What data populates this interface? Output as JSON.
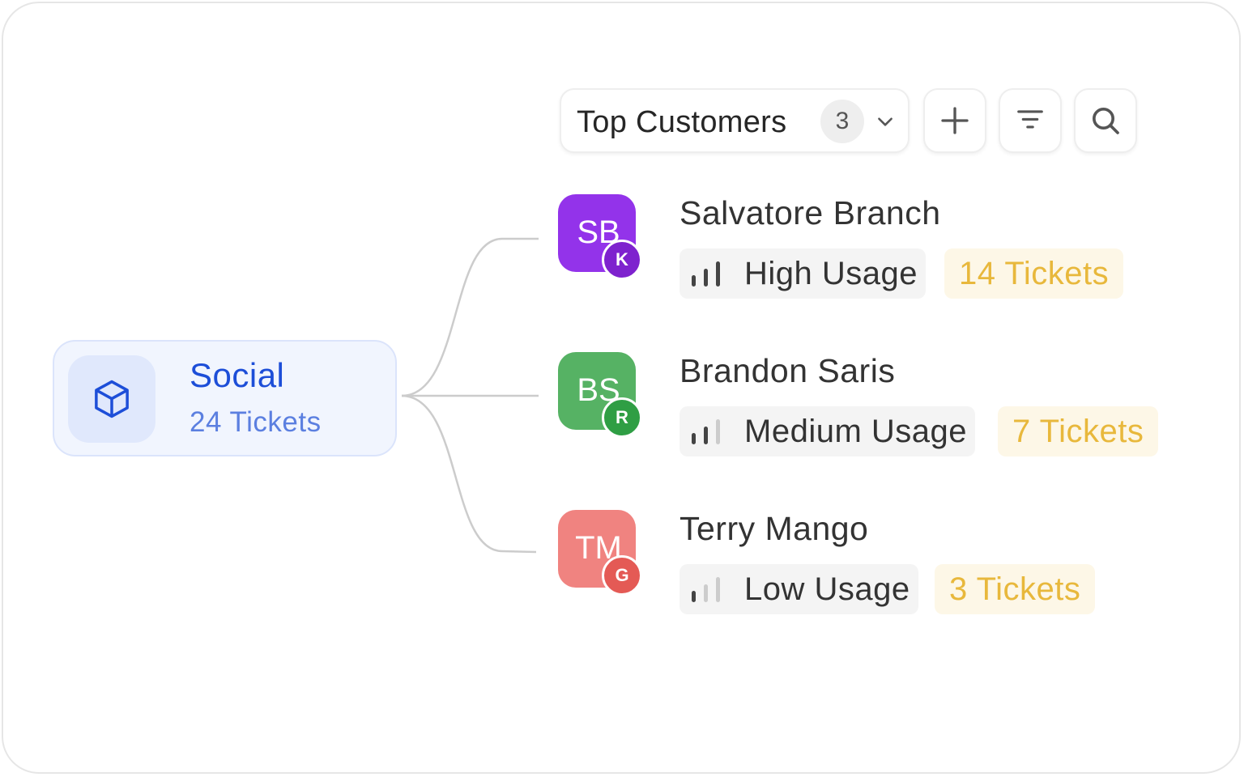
{
  "colors": {
    "primary_blue": "#1d4ed8",
    "tickets_text": "#e8b83c",
    "tickets_bg": "#fdf7e7",
    "usage_bg": "#f4f4f4"
  },
  "category": {
    "icon": "cube-icon",
    "title": "Social",
    "tickets": "24 Tickets"
  },
  "toolbar": {
    "dropdown_label": "Top Customers",
    "count": "3",
    "dropdown_icon": "chevron-down-icon",
    "add_icon": "plus-icon",
    "filter_icon": "filter-icon",
    "search_icon": "search-icon"
  },
  "customers": [
    {
      "initials": "SB",
      "badge": "K",
      "name": "Salvatore Branch",
      "usage": "High Usage",
      "usage_level": 3,
      "tickets": "14 Tickets",
      "avatar_color": "#9333ea",
      "badge_color": "#7e22ce"
    },
    {
      "initials": "BS",
      "badge": "R",
      "name": "Brandon Saris",
      "usage": "Medium Usage",
      "usage_level": 2,
      "tickets": "7 Tickets",
      "avatar_color": "#56b264",
      "badge_color": "#2f9e44"
    },
    {
      "initials": "TM",
      "badge": "G",
      "name": "Terry Mango",
      "usage": "Low Usage",
      "usage_level": 1,
      "tickets": "3 Tickets",
      "avatar_color": "#f08380",
      "badge_color": "#e45a55"
    }
  ]
}
